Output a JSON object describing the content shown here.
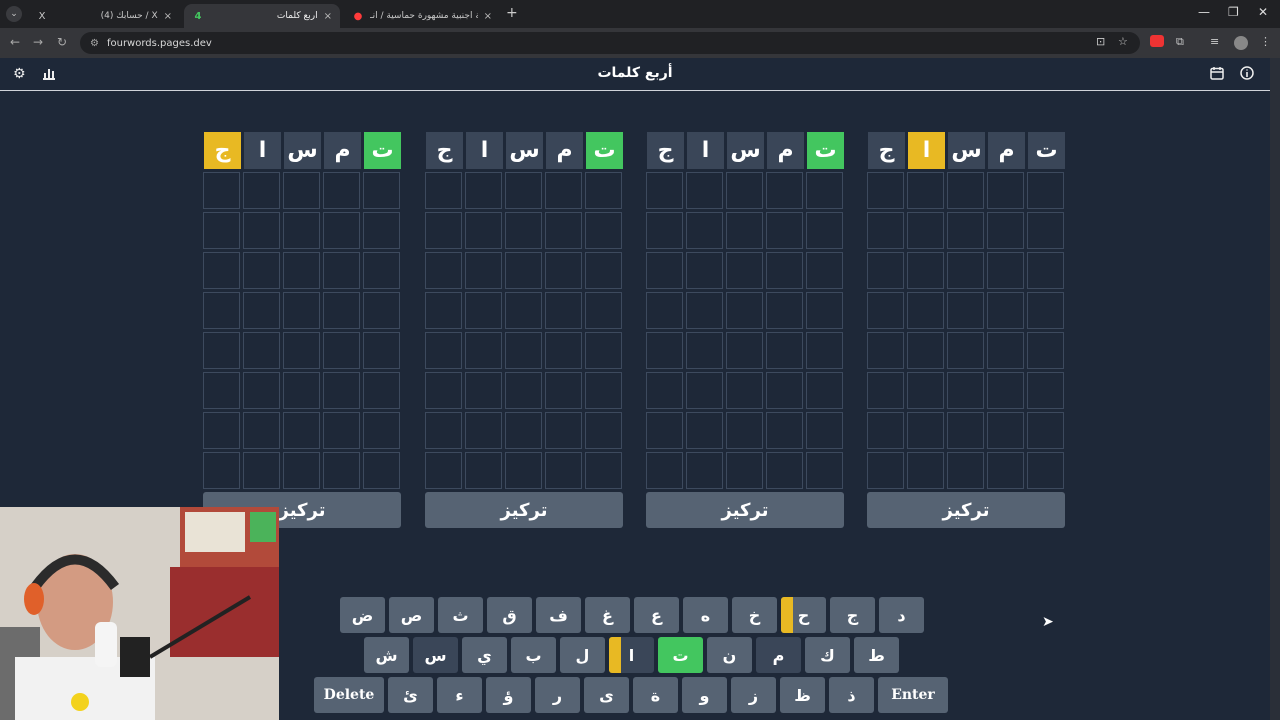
{
  "tabs": [
    {
      "title": "(4) حسابك / X",
      "close": "×",
      "favicon": "X",
      "active": false
    },
    {
      "title": "أربع كلمات",
      "close": "×",
      "favicon": "4",
      "active": true
    },
    {
      "title": "اغنية اجنبية مشهورة حماسية / انـ...",
      "close": "×",
      "favicon": "●",
      "active": false
    }
  ],
  "new_tab": "+",
  "url": "fourwords.pages.dev",
  "app": {
    "title": "أربع كلمات"
  },
  "icons": {
    "settings": "⚙",
    "stats": "📊",
    "calendar": "📅",
    "info": "ⓘ"
  },
  "boards": [
    {
      "guess": [
        {
          "l": "ت",
          "s": "green"
        },
        {
          "l": "م",
          "s": "filled"
        },
        {
          "l": "س",
          "s": "filled"
        },
        {
          "l": "ا",
          "s": "filled"
        },
        {
          "l": "ج",
          "s": "yellow"
        }
      ],
      "focus": "تركيز"
    },
    {
      "guess": [
        {
          "l": "ت",
          "s": "green"
        },
        {
          "l": "م",
          "s": "filled"
        },
        {
          "l": "س",
          "s": "filled"
        },
        {
          "l": "ا",
          "s": "filled"
        },
        {
          "l": "ج",
          "s": "filled"
        }
      ],
      "focus": "تركيز"
    },
    {
      "guess": [
        {
          "l": "ت",
          "s": "green"
        },
        {
          "l": "م",
          "s": "filled"
        },
        {
          "l": "س",
          "s": "filled"
        },
        {
          "l": "ا",
          "s": "filled"
        },
        {
          "l": "ج",
          "s": "filled"
        }
      ],
      "focus": "تركيز"
    },
    {
      "guess": [
        {
          "l": "ت",
          "s": "filled"
        },
        {
          "l": "م",
          "s": "filled"
        },
        {
          "l": "س",
          "s": "filled"
        },
        {
          "l": "ا",
          "s": "yellow"
        },
        {
          "l": "ج",
          "s": "filled"
        }
      ],
      "focus": "تركيز"
    }
  ],
  "keyboard": {
    "row1": [
      "د",
      "ج",
      "ح",
      "خ",
      "ه",
      "ع",
      "غ",
      "ف",
      "ق",
      "ث",
      "ص",
      "ض"
    ],
    "row2": [
      "ط",
      "ك",
      "م",
      "ن",
      "ت",
      "ا",
      "ل",
      "ب",
      "ي",
      "س",
      "ش"
    ],
    "row3": [
      "Enter",
      "ذ",
      "ظ",
      "ز",
      "و",
      "ة",
      "ى",
      "ر",
      "ؤ",
      "ء",
      "ئ",
      "Delete"
    ]
  },
  "colors": {
    "green": "#43c65f",
    "yellow": "#e8b923",
    "key": "#566373",
    "bg": "#1e2838"
  }
}
